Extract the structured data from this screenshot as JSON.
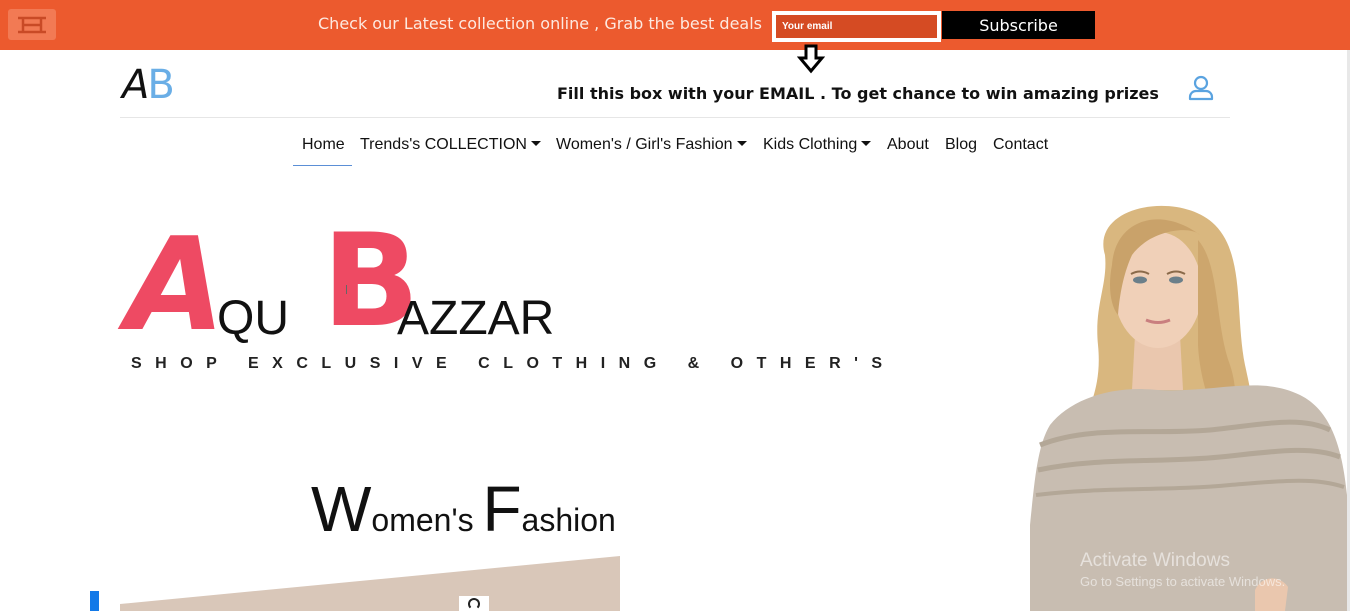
{
  "promo": {
    "message": "Check our Latest collection online , Grab the best deals",
    "email_placeholder": "Your email",
    "subscribe_label": "Subscribe",
    "bar_color": "#ec5a2e"
  },
  "header": {
    "brand_a": "A",
    "brand_b": "B",
    "hint": "Fill this box with your EMAIL . To get chance to win amazing prizes",
    "user_icon": "user-icon",
    "arrow_icon": "arrow-down-icon"
  },
  "nav": {
    "items": [
      {
        "label": "Home",
        "dropdown": false,
        "active": true
      },
      {
        "label": "Trends's COLLECTION",
        "dropdown": true
      },
      {
        "label": "Women's / Girl's Fashion",
        "dropdown": true
      },
      {
        "label": "Kids Clothing",
        "dropdown": true
      },
      {
        "label": "About",
        "dropdown": false
      },
      {
        "label": "Blog",
        "dropdown": false
      },
      {
        "label": "Contact",
        "dropdown": false
      }
    ]
  },
  "hero": {
    "letter_a": "A",
    "word_qu": "QU",
    "letter_b": "B",
    "word_azzar": "AZZAR",
    "tagline": "SHOP EXCLUSIVE CLOTHING & OTHER'S",
    "accent_color": "#ee4a63"
  },
  "section": {
    "cap_w": "W",
    "rest_w": "omen's ",
    "cap_f": "F",
    "rest_f": "ashion"
  },
  "watermark": {
    "line1": "Activate Windows",
    "line2": "Go to Settings to activate Windows."
  }
}
